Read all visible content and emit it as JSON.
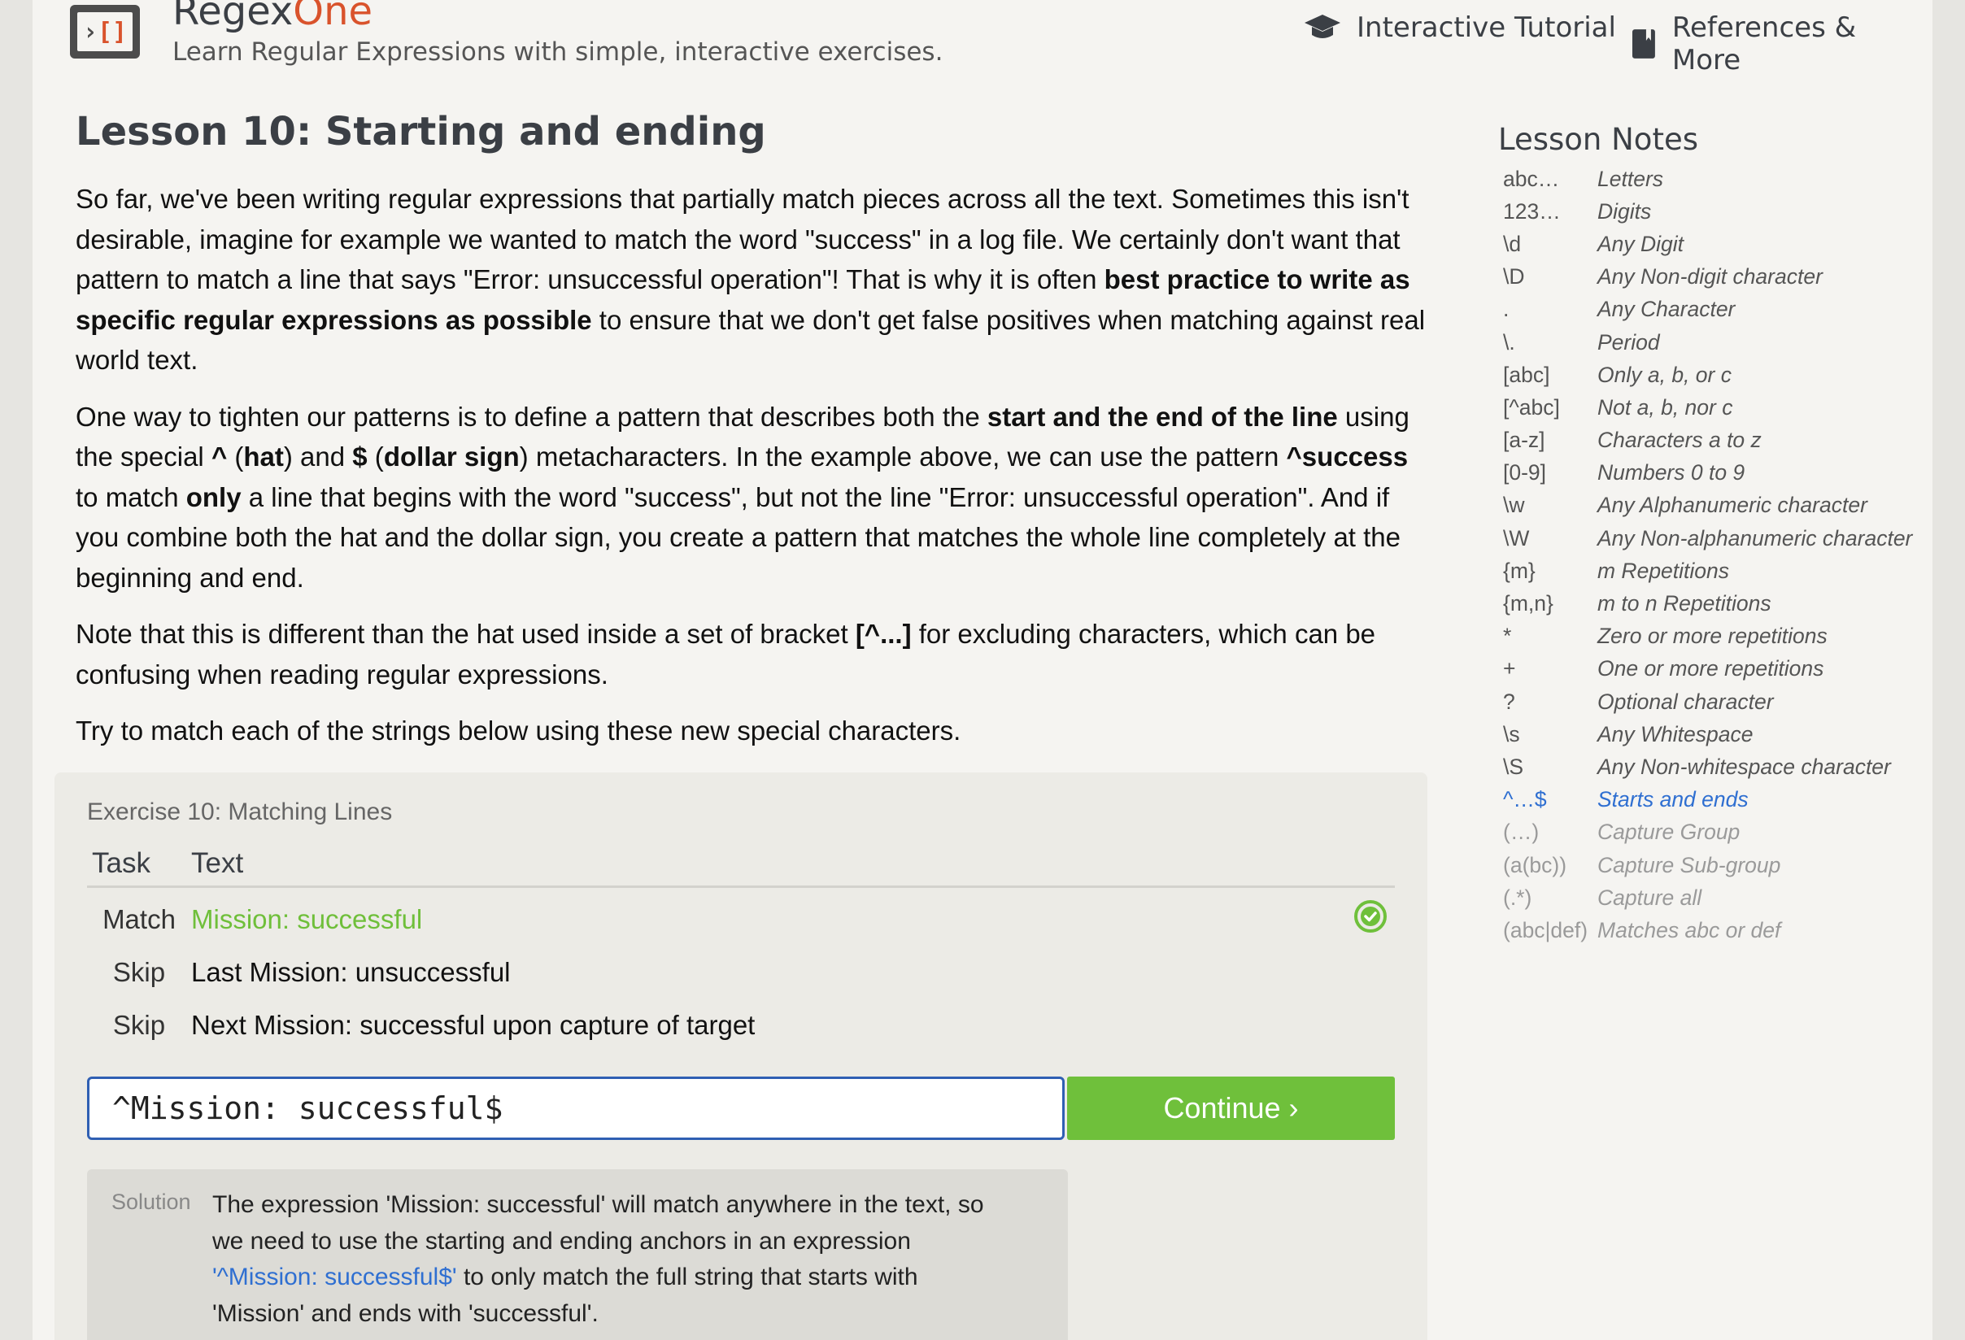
{
  "header": {
    "brand_main": "Regex",
    "brand_accent": "One",
    "tagline": "Learn Regular Expressions with simple, interactive exercises.",
    "nav": {
      "tutorial": "Interactive Tutorial",
      "references": "References & More"
    },
    "logo_gt": "›",
    "logo_brackets": "[]"
  },
  "lesson": {
    "title": "Lesson 10: Starting and ending",
    "p1": {
      "a": "So far, we've been writing regular expressions that partially match pieces across all the text. Sometimes this isn't desirable, imagine for example we wanted to match the word \"success\" in a log file. We certainly don't want that pattern to match a line that says \"Error: unsuccessful operation\"! That is why it is often ",
      "b": "best practice to write as specific regular expressions as possible",
      "c": " to ensure that we don't get false positives when matching against real world text."
    },
    "p2": {
      "a": "One way to tighten our patterns is to define a pattern that describes both the ",
      "b": "start and the end of the line",
      "c": " using the special ",
      "d": "^",
      "e": " (",
      "f": "hat",
      "g": ") and ",
      "h": "$",
      "i": " (",
      "j": "dollar sign",
      "k": ") metacharacters. In the example above, we can use the pattern ",
      "l": "^success",
      "m": " to match ",
      "n": "only",
      "o": " a line that begins with the word \"success\", but not the line \"Error: unsuccessful operation\". And if you combine both the hat and the dollar sign, you create a pattern that matches the whole line completely at the beginning and end."
    },
    "p3": {
      "a": "Note that this is different than the hat used inside a set of bracket ",
      "b": "[^...]",
      "c": " for excluding characters, which can be confusing when reading regular expressions."
    },
    "p4": "Try to match each of the strings below using these new special characters."
  },
  "notes": {
    "title": "Lesson Notes",
    "items": [
      {
        "sym": "abc…",
        "desc": "Letters"
      },
      {
        "sym": "123…",
        "desc": "Digits"
      },
      {
        "sym": "\\d",
        "desc": "Any Digit"
      },
      {
        "sym": "\\D",
        "desc": "Any Non-digit character"
      },
      {
        "sym": ".",
        "desc": "Any Character"
      },
      {
        "sym": "\\.",
        "desc": "Period"
      },
      {
        "sym": "[abc]",
        "desc": "Only a, b, or c"
      },
      {
        "sym": "[^abc]",
        "desc": "Not a, b, nor c"
      },
      {
        "sym": "[a-z]",
        "desc": "Characters a to z"
      },
      {
        "sym": "[0-9]",
        "desc": "Numbers 0 to 9"
      },
      {
        "sym": "\\w",
        "desc": "Any Alphanumeric character"
      },
      {
        "sym": "\\W",
        "desc": "Any Non-alphanumeric character"
      },
      {
        "sym": "{m}",
        "desc": "m Repetitions"
      },
      {
        "sym": "{m,n}",
        "desc": "m to n Repetitions"
      },
      {
        "sym": "*",
        "desc": "Zero or more repetitions"
      },
      {
        "sym": "+",
        "desc": "One or more repetitions"
      },
      {
        "sym": "?",
        "desc": "Optional character"
      },
      {
        "sym": "\\s",
        "desc": "Any Whitespace"
      },
      {
        "sym": "\\S",
        "desc": "Any Non-whitespace character"
      },
      {
        "sym": "^…$",
        "desc": "Starts and ends"
      },
      {
        "sym": "(…)",
        "desc": "Capture Group"
      },
      {
        "sym": "(a(bc))",
        "desc": "Capture Sub-group"
      },
      {
        "sym": "(.*)",
        "desc": "Capture all"
      },
      {
        "sym": "(abc|def)",
        "desc": "Matches abc or def"
      }
    ]
  },
  "exercise": {
    "title": "Exercise 10: Matching Lines",
    "headers": {
      "task": "Task",
      "text": "Text"
    },
    "rows": [
      {
        "task": "Match",
        "text": "Mission: successful",
        "status": "passed"
      },
      {
        "task": "Skip",
        "text": "Last Mission: unsuccessful",
        "status": ""
      },
      {
        "task": "Skip",
        "text": "Next Mission: successful upon capture of target",
        "status": ""
      }
    ],
    "input_value": "^Mission: successful$",
    "continue_label": "Continue ›",
    "solution": {
      "label": "Solution",
      "a": "The expression 'Mission: successful' will match anywhere in the text, so we need to use the starting and ending anchors in an expression ",
      "code": "'^Mission: successful$'",
      "b": " to only match the full string that starts with 'Mission' and ends with 'successful'."
    }
  },
  "colors": {
    "accent_orange": "#d9532c",
    "success_green": "#6fc03b",
    "link_blue": "#2f6fd1",
    "heading": "#3b3f45"
  }
}
